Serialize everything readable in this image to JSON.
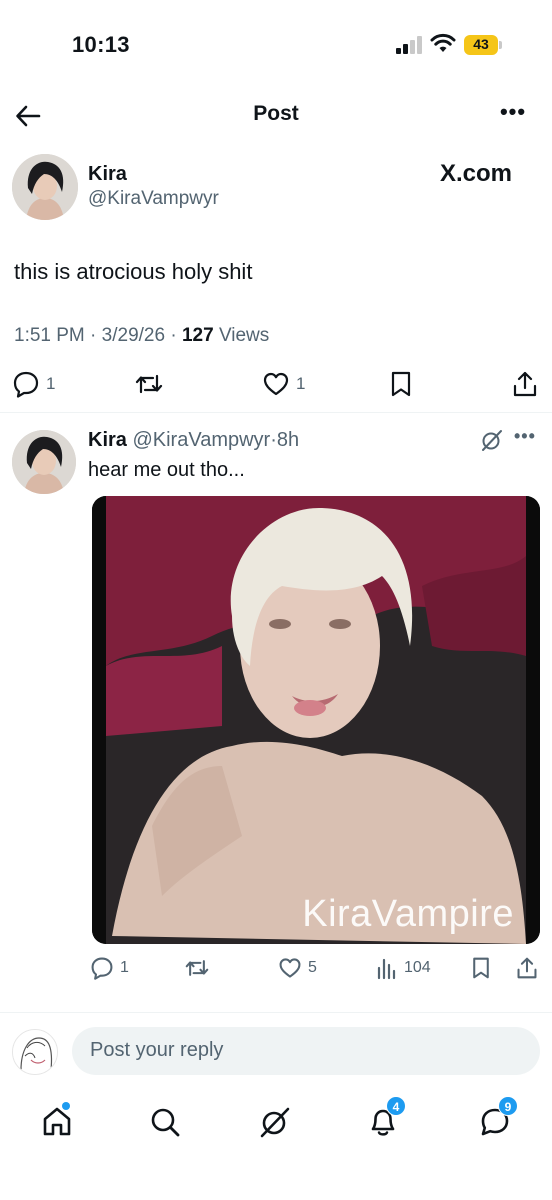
{
  "status_bar": {
    "time": "10:13",
    "battery": "43"
  },
  "header": {
    "title": "Post"
  },
  "main_post": {
    "author_name": "Kira",
    "author_handle": "@KiraVampwyr",
    "brand": "X.com",
    "text": "this is atrocious holy shit",
    "time": "1:51 PM",
    "date": "3/29/26",
    "views_count": "127",
    "views_label": "Views",
    "replies": "1",
    "likes": "1"
  },
  "reply_post": {
    "author_name": "Kira",
    "author_handle": "@KiraVampwyr",
    "time_ago": "8h",
    "text": "hear me out tho...",
    "image_watermark": "KiraVampire",
    "replies": "1",
    "likes": "5",
    "views": "104"
  },
  "composer": {
    "placeholder": "Post your reply"
  },
  "tabbar": {
    "notifications_badge": "4",
    "messages_badge": "9"
  },
  "colors": {
    "accent": "#1d9bf0",
    "muted": "#536471",
    "battery": "#f5c518"
  }
}
